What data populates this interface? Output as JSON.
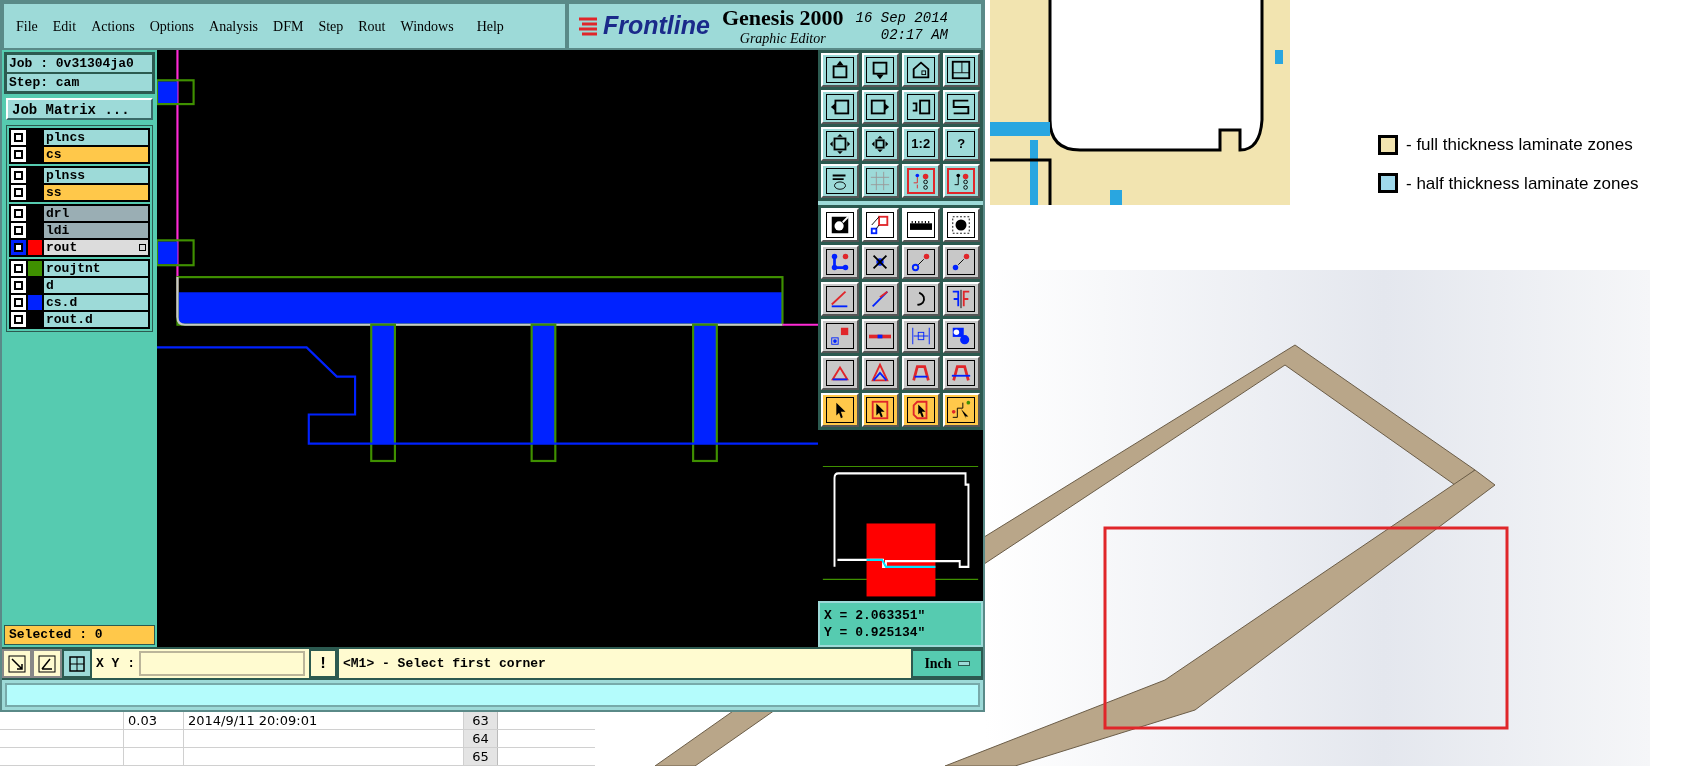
{
  "menu": [
    "File",
    "Edit",
    "Actions",
    "Options",
    "Analysis",
    "DFM",
    "Step",
    "Rout",
    "Windows",
    "Help"
  ],
  "brand": {
    "logo": "Frontline",
    "product": "Genesis 2000",
    "subtitle": "Graphic Editor",
    "date": "16 Sep 2014",
    "time": "02:17 AM"
  },
  "job": {
    "job": "Job : 0v31304ja0",
    "step": "Step: cam",
    "matrix_button": "Job Matrix ..."
  },
  "layer_groups": [
    {
      "layers": [
        {
          "name": "plncs",
          "kind": "plain",
          "selected": false,
          "affected": true
        },
        {
          "name": "cs",
          "kind": "signal",
          "selected": false,
          "affected": true
        }
      ]
    },
    {
      "layers": [
        {
          "name": "plnss",
          "kind": "plain",
          "selected": false,
          "affected": true
        },
        {
          "name": "ss",
          "kind": "signal",
          "selected": false,
          "affected": true
        }
      ]
    },
    {
      "layers": [
        {
          "name": "drl",
          "kind": "drill",
          "selected": false,
          "affected": true
        },
        {
          "name": "ldi",
          "kind": "drill",
          "selected": false,
          "affected": true
        },
        {
          "name": "rout",
          "kind": "drill",
          "selected": true,
          "affected": true,
          "color": "#ff0000"
        }
      ]
    },
    {
      "layers": [
        {
          "name": "roujtnt",
          "kind": "plain",
          "selected": false,
          "affected": true,
          "color": "#3f9000"
        },
        {
          "name": "d",
          "kind": "plain",
          "selected": false,
          "affected": true
        },
        {
          "name": "cs.d",
          "kind": "plain",
          "selected": false,
          "affected": true,
          "color": "#0022ff"
        },
        {
          "name": "rout.d",
          "kind": "plain",
          "selected": false,
          "affected": true
        }
      ]
    }
  ],
  "selected_count": "Selected : 0",
  "toolbar": [
    {
      "kind": "teal",
      "highlighted": false
    },
    {
      "kind": "teal",
      "highlighted": false
    },
    {
      "kind": "teal",
      "highlighted": false
    },
    {
      "kind": "teal",
      "highlighted": false
    },
    {
      "kind": "teal",
      "highlighted": false
    },
    {
      "kind": "teal",
      "highlighted": false
    },
    {
      "kind": "teal",
      "highlighted": false
    },
    {
      "kind": "teal",
      "highlighted": false
    },
    {
      "kind": "teal",
      "highlighted": false
    },
    {
      "kind": "teal",
      "highlighted": false
    },
    {
      "kind": "teal",
      "highlighted": false,
      "label": "1:2"
    },
    {
      "kind": "teal",
      "highlighted": false,
      "label": "?"
    },
    {
      "kind": "teal",
      "highlighted": false
    },
    {
      "kind": "teal",
      "highlighted": false
    },
    {
      "kind": "teal",
      "highlighted": true
    },
    {
      "kind": "teal",
      "highlighted": true
    },
    {
      "kind": "white",
      "highlighted": false
    },
    {
      "kind": "white",
      "highlighted": false
    },
    {
      "kind": "white",
      "highlighted": false
    },
    {
      "kind": "white",
      "highlighted": false
    },
    {
      "kind": "grey",
      "highlighted": false
    },
    {
      "kind": "grey",
      "highlighted": false
    },
    {
      "kind": "grey",
      "highlighted": false
    },
    {
      "kind": "grey",
      "highlighted": false
    },
    {
      "kind": "grey",
      "highlighted": false
    },
    {
      "kind": "grey",
      "highlighted": false
    },
    {
      "kind": "grey",
      "highlighted": false
    },
    {
      "kind": "grey",
      "highlighted": false
    },
    {
      "kind": "grey",
      "highlighted": false
    },
    {
      "kind": "grey",
      "highlighted": false
    },
    {
      "kind": "grey",
      "highlighted": false
    },
    {
      "kind": "grey",
      "highlighted": false
    },
    {
      "kind": "grey",
      "highlighted": false
    },
    {
      "kind": "grey",
      "highlighted": false
    },
    {
      "kind": "grey",
      "highlighted": false
    },
    {
      "kind": "grey",
      "highlighted": false
    },
    {
      "kind": "orange",
      "highlighted": false
    },
    {
      "kind": "orange",
      "highlighted": false
    },
    {
      "kind": "orange",
      "highlighted": false
    },
    {
      "kind": "orange",
      "highlighted": false
    }
  ],
  "coordinates": {
    "x": "X = 2.063351\"",
    "y": "Y = 0.925134\""
  },
  "input_bar": {
    "xy_label": "X Y :",
    "alert": "!",
    "prompt": "<M1> - Select first corner",
    "units": "Inch"
  },
  "spreadsheet": {
    "rows": [
      {
        "cells": [
          "0.03",
          "2014/9/11 20:09:01"
        ],
        "number": "63"
      },
      {
        "cells": [],
        "number": "64"
      },
      {
        "cells": [],
        "number": "65"
      }
    ]
  },
  "legend": [
    {
      "label": "- full thickness laminate zones",
      "color": "#f2e4b0"
    },
    {
      "label": "- half thickness laminate zones",
      "color": "#9fd9ec"
    }
  ]
}
